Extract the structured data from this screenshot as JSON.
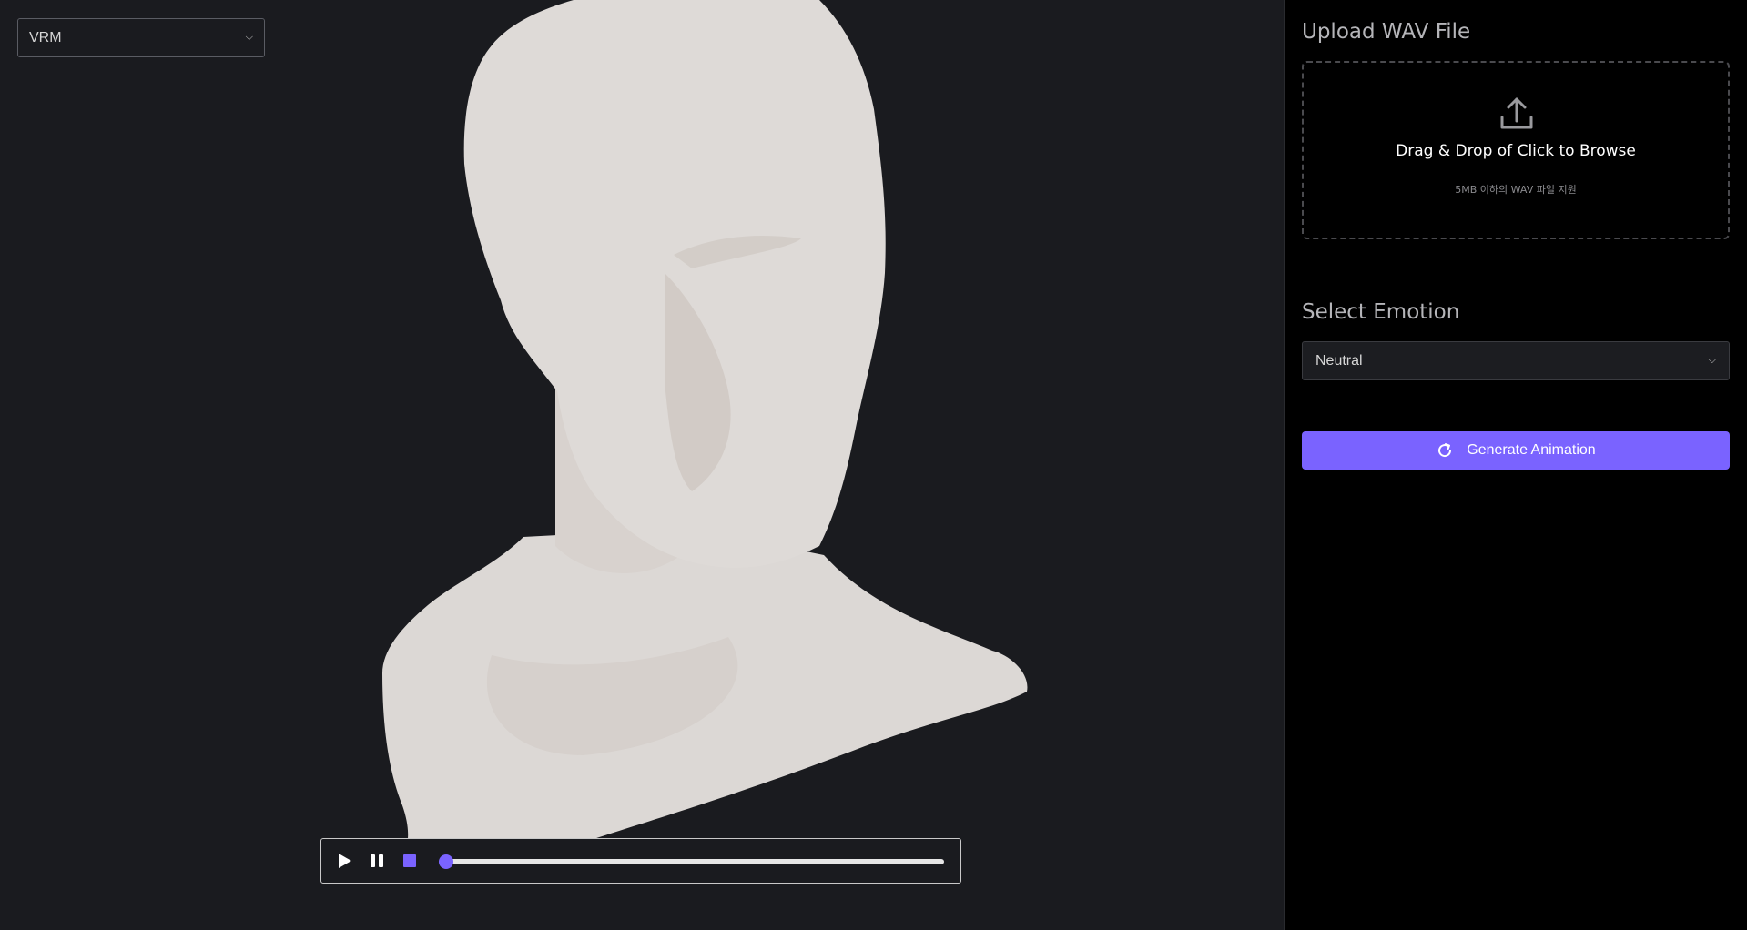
{
  "viewer": {
    "model_select": "VRM",
    "player": {
      "progress": 0.0
    }
  },
  "sidebar": {
    "upload": {
      "heading": "Upload WAV File",
      "drop_title": "Drag & Drop of Click to Browse",
      "drop_hint": "5MB 이하의 WAV 파일 지원"
    },
    "emotion": {
      "heading": "Select Emotion",
      "selected": "Neutral"
    },
    "generate_label": "Generate Animation"
  },
  "colors": {
    "accent": "#7a63ff",
    "viewport_bg": "#1a1b1f",
    "sidebar_bg": "#000000",
    "bust": "#dcd8d5"
  }
}
